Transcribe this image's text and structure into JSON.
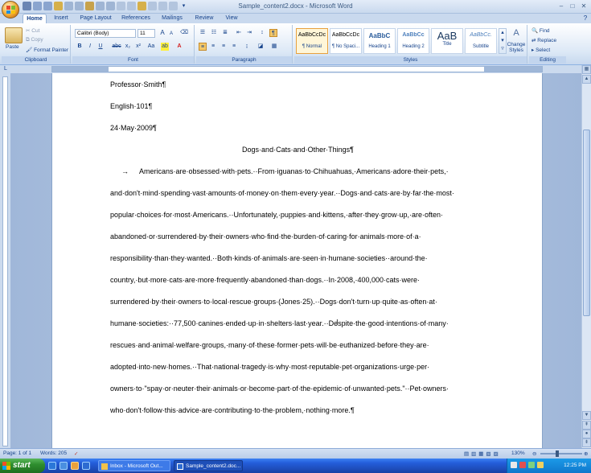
{
  "window": {
    "title": "Sample_content2.docx - Microsoft Word",
    "controls": {
      "minimize": "–",
      "maximize": "□",
      "close": "✕"
    }
  },
  "tabs": [
    {
      "label": "Home",
      "active": true
    },
    {
      "label": "Insert"
    },
    {
      "label": "Page Layout"
    },
    {
      "label": "References"
    },
    {
      "label": "Mailings"
    },
    {
      "label": "Review"
    },
    {
      "label": "View"
    }
  ],
  "ribbon": {
    "clipboard": {
      "label": "Clipboard",
      "paste": "Paste",
      "cut": "Cut",
      "copy": "Copy",
      "format_painter": "Format Painter"
    },
    "font": {
      "label": "Font",
      "family": "Calibri (Body)",
      "size": "11",
      "bold": "B",
      "italic": "I",
      "underline": "U",
      "strike": "abc",
      "subscript": "x₂",
      "superscript": "x²",
      "change_case": "Aa",
      "grow": "A",
      "shrink": "A"
    },
    "paragraph": {
      "label": "Paragraph",
      "pilcrow": "¶"
    },
    "styles": {
      "label": "Styles",
      "items": [
        {
          "sample": "AaBbCcDc",
          "name": "¶ Normal",
          "selected": true
        },
        {
          "sample": "AaBbCcDc",
          "name": "¶ No Spaci..."
        },
        {
          "sample": "AaBbC",
          "name": "Heading 1"
        },
        {
          "sample": "AaBbCc",
          "name": "Heading 2"
        },
        {
          "sample": "AaB",
          "name": "Title"
        },
        {
          "sample": "AaBbCc.",
          "name": "Subtitle"
        }
      ],
      "change_styles": "Change Styles"
    },
    "editing": {
      "label": "Editing",
      "find": "Find",
      "replace": "Replace",
      "select": "Select"
    }
  },
  "document": {
    "lines": [
      "Professor·Smith¶",
      "English·101¶",
      "24·May·2009¶",
      "Dogs·and·Cats·and·Other·Things¶",
      "Americans·are·obsessed·with·pets.··From·iguanas·to·Chihuahuas,·Americans·adore·their·pets,·",
      "and·don't·mind·spending·vast·amounts·of·money·on·them·every·year.··Dogs·and·cats·are·by·far·the·most·",
      "popular·choices·for·most·Americans.··Unfortunately,·puppies·and·kittens,·after·they·grow·up,·are·often·",
      "abandoned·or·surrendered·by·their·owners·who·find·the·burden·of·caring·for·animals·more·of·a·",
      "responsibility·than·they·wanted.··Both·kinds·of·animals·are·seen·in·humane·societies··around·the·",
      "country,·but·more·cats·are·more·frequently·abandoned·than·dogs.··In·2008,·400,000·cats·were·",
      "surrendered·by·their·owners·to·local·rescue·groups·(Jones·25).··Dogs·don't·turn·up·quite·as·often·at·",
      "humane·societies:··77,500·canines·ended·up·in·shelters·last·year.··Despite·the·good·intentions·of·many·",
      "rescues·and·animal·welfare·groups,·many·of·these·former·pets·will·be·euthanized·before·they·are·",
      "adopted·into·new·homes.··That·national·tragedy·is·why·most·reputable·pet·organizations·urge·per·",
      "owners·to·\"spay·or·neuter·their·animals·or·become·part·of·the·epidemic·of·unwanted·pets.\"··Pet·owners·",
      "who·don't·follow·this·advice·are·contributing·to·the·problem,·nothing·more.¶"
    ],
    "tab_marker": "→"
  },
  "statusbar": {
    "page": "Page: 1 of 1",
    "words": "Words: 205",
    "zoom": "130%"
  },
  "taskbar": {
    "start": "start",
    "tasks": [
      {
        "label": "Inbox - Microsoft Out..."
      },
      {
        "label": "Sample_content2.doc..."
      }
    ],
    "clock": "12:25 PM"
  }
}
